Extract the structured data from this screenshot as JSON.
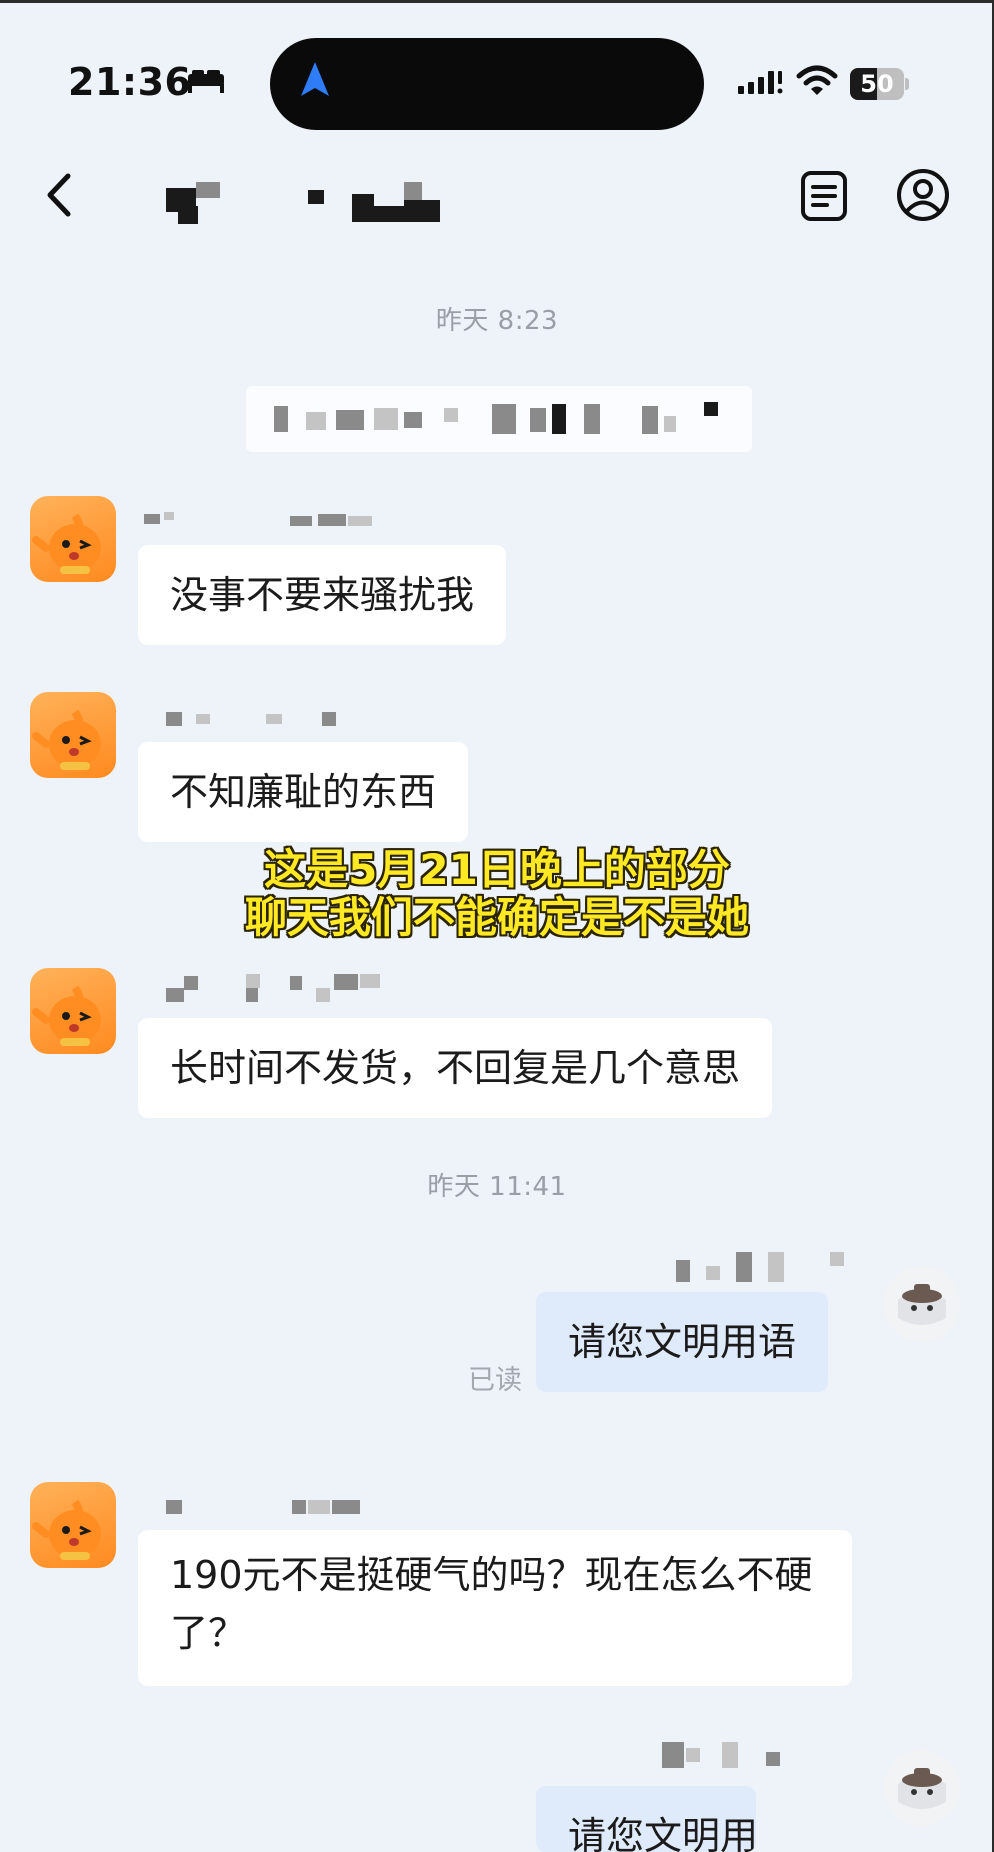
{
  "status_bar": {
    "time": "21:36",
    "battery": "50",
    "battery_level": 0.5
  },
  "header": {
    "back_icon": "chevron-left-icon",
    "notes_icon": "document-list-icon",
    "profile_icon": "person-circle-icon"
  },
  "messages": {
    "timestamp_1": "昨天 8:23",
    "msg_1": "没事不要来骚扰我",
    "msg_2": "不知廉耻的东西",
    "msg_3": "长时间不发货，不回复是几个意思",
    "timestamp_2": "昨天 11:41",
    "reply_1": "请您文明用语",
    "read_label": "已读",
    "msg_4": "190元不是挺硬气的吗？现在怎么不硬了？",
    "reply_2_partial": "请您文明用"
  },
  "overlay_caption": {
    "line_1": "这是5月21日晚上的部分",
    "line_2": "聊天我们不能确定是不是她"
  },
  "colors": {
    "background": "#eef2f9",
    "incoming_bubble": "#ffffff",
    "outgoing_bubble": "#dfebfb",
    "caption": "#ffe824",
    "avatar": "#ff9a2e"
  }
}
